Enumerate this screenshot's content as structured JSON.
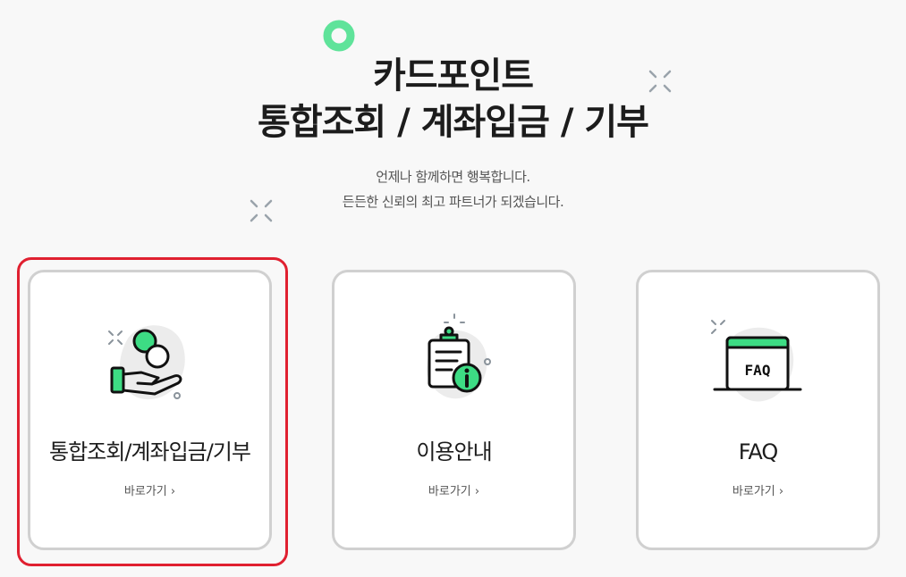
{
  "header": {
    "title_line1": "카드포인트",
    "title_line2": "통합조회 / 계좌입금 / 기부",
    "subtitle_line1": "언제나 함께하면 행복합니다.",
    "subtitle_line2": "든든한 신뢰의 최고 파트너가 되겠습니다."
  },
  "cards": [
    {
      "label": "통합조회/계좌입금/기부",
      "link": "바로가기 ›",
      "icon": "hand-coins-icon",
      "selected": true
    },
    {
      "label": "이용안내",
      "link": "바로가기 ›",
      "icon": "clipboard-info-icon",
      "selected": false
    },
    {
      "label": "FAQ",
      "link": "바로가기 ›",
      "icon": "faq-window-icon",
      "selected": false
    }
  ],
  "icons": {
    "faq_text": "FAQ"
  },
  "colors": {
    "accent_green": "#3ddc84",
    "highlight_red": "#e02030",
    "card_border": "#d0d0d0",
    "blob_gray": "#ececec"
  }
}
